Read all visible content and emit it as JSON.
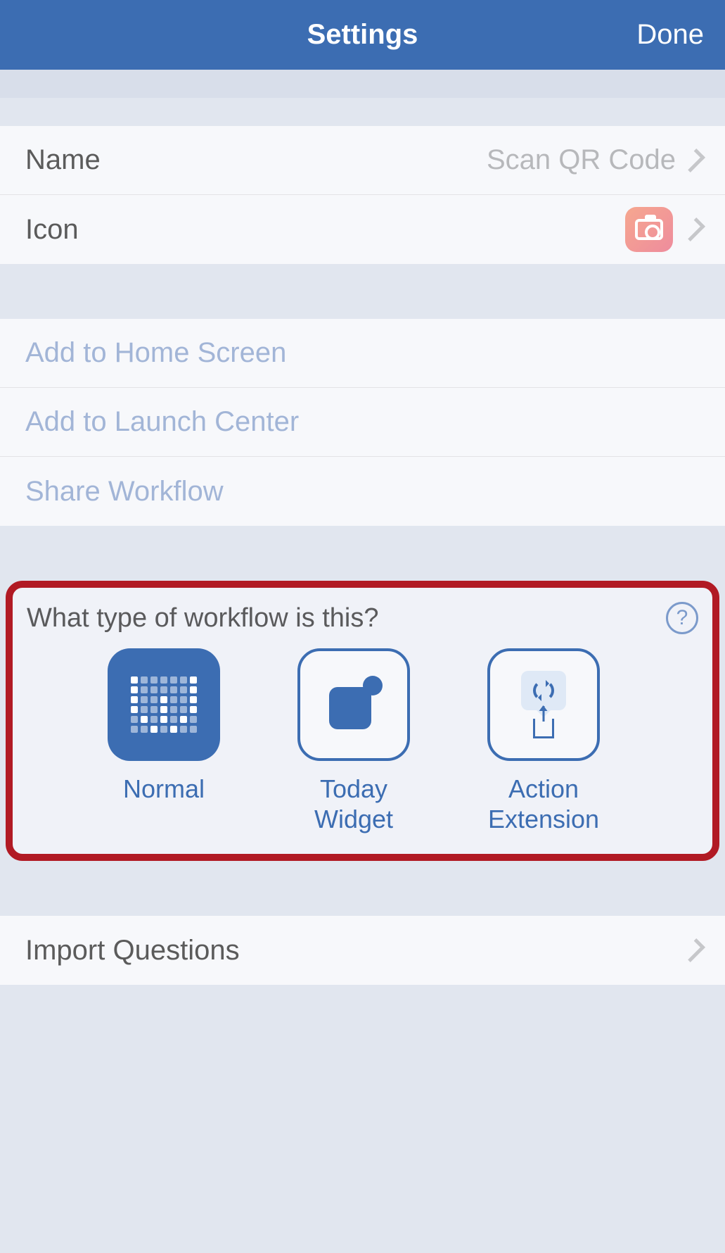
{
  "nav": {
    "title": "Settings",
    "done": "Done"
  },
  "rows": {
    "name_label": "Name",
    "name_value": "Scan QR Code",
    "icon_label": "Icon",
    "icon_name": "camera-icon"
  },
  "actions": {
    "home_screen": "Add to Home Screen",
    "launch_center": "Add to Launch Center",
    "share": "Share Workflow"
  },
  "workflow_type": {
    "heading": "What type of workflow is this?",
    "help_glyph": "?",
    "options": [
      {
        "label": "Normal",
        "selected": true
      },
      {
        "label": "Today Widget",
        "selected": false
      },
      {
        "label": "Action Extension",
        "selected": false
      }
    ]
  },
  "import_label": "Import Questions"
}
